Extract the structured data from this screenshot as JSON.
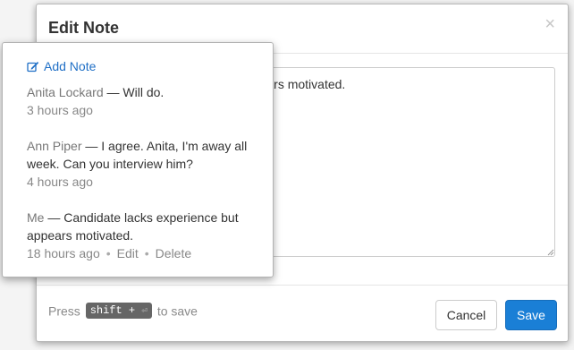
{
  "modal": {
    "title": "Edit Note",
    "close_glyph": "×",
    "textarea_value": "Candidate lacks experience but appears motivated.",
    "footer": {
      "hint_prefix": "Press",
      "hint_keys": "shift +",
      "hint_enter_glyph": "⏎",
      "hint_suffix": "to save",
      "cancel_label": "Cancel",
      "save_label": "Save"
    }
  },
  "popover": {
    "add_note_label": "Add Note",
    "separator": " — ",
    "notes": [
      {
        "author": "Anita Lockard",
        "text": "Will do.",
        "time": "3 hours ago"
      },
      {
        "author": "Ann Piper",
        "text": "I agree. Anita, I'm away all week. Can you interview him?",
        "time": "4 hours ago"
      },
      {
        "author": "Me",
        "text": "Candidate lacks experience but appears motivated.",
        "time": "18 hours ago",
        "edit_label": "Edit",
        "delete_label": "Delete",
        "dot": "•"
      }
    ]
  },
  "colors": {
    "primary": "#1a7fd6",
    "link": "#1f6fc6"
  }
}
